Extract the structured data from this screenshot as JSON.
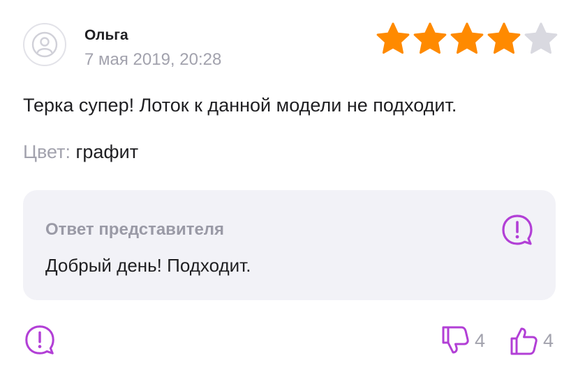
{
  "review": {
    "author": "Ольга",
    "date": "7 мая 2019, 20:28",
    "rating": 4,
    "rating_max": 5,
    "text": "Терка супер! Лоток к данной модели не подходит.",
    "color_label": "Цвет:",
    "color_value": "графит"
  },
  "answer": {
    "title": "Ответ представителя",
    "text": "Добрый день! Подходит."
  },
  "votes": {
    "dislikes": "4",
    "likes": "4"
  },
  "colors": {
    "star_filled": "#FF8A00",
    "star_empty": "#D9D9E0",
    "accent": "#B23FD6",
    "muted_text": "#A2A2AD",
    "panel_bg": "#F2F2F7"
  },
  "icons": {
    "avatar": "user-icon",
    "report": "exclamation-bubble-icon",
    "dislike": "thumbs-down-icon",
    "like": "thumbs-up-icon"
  }
}
